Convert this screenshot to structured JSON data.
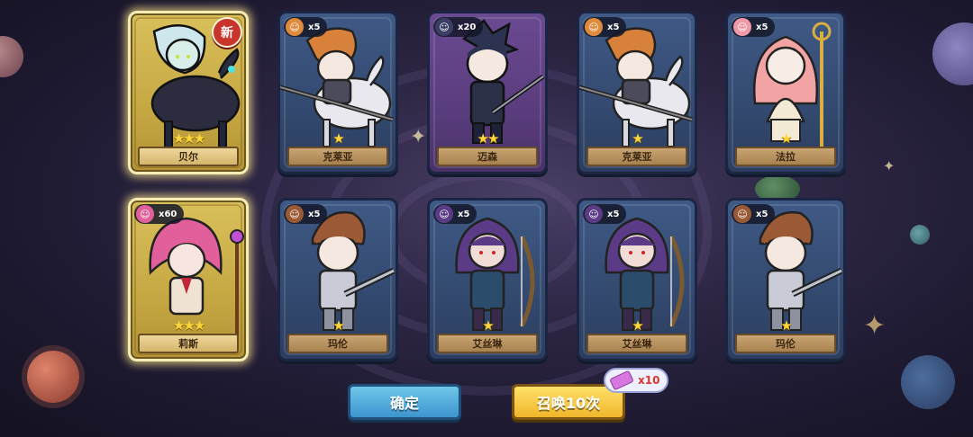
{
  "colors": {
    "gold_card": "#d2b54f",
    "blue_card": "#3f5a86",
    "purple_card": "#6a4a92",
    "star": "#ffd53a",
    "confirm_button": "#4aa6db",
    "summon_button": "#f4c43a",
    "cost_text": "#d83a2a"
  },
  "cards": [
    {
      "name": "贝尔",
      "count": "",
      "stars": "★★★",
      "rarity": "gold",
      "is_new": true,
      "new_label": "新",
      "icon": "dark-rider-portrait"
    },
    {
      "name": "克莱亚",
      "count": "x5",
      "stars": "★",
      "rarity": "blue",
      "is_new": false,
      "icon": "lance-rider-portrait"
    },
    {
      "name": "迈森",
      "count": "x20",
      "stars": "★★",
      "rarity": "purple",
      "is_new": false,
      "icon": "swordsman-portrait"
    },
    {
      "name": "克莱亚",
      "count": "x5",
      "stars": "★",
      "rarity": "blue",
      "is_new": false,
      "icon": "lance-rider-portrait"
    },
    {
      "name": "法拉",
      "count": "x5",
      "stars": "★",
      "rarity": "blue",
      "is_new": false,
      "icon": "priestess-portrait"
    },
    {
      "name": "莉斯",
      "count": "x60",
      "stars": "★★★",
      "rarity": "gold",
      "is_new": false,
      "icon": "mage-girl-portrait"
    },
    {
      "name": "玛伦",
      "count": "x5",
      "stars": "★",
      "rarity": "blue",
      "is_new": false,
      "icon": "knight-portrait"
    },
    {
      "name": "艾丝琳",
      "count": "x5",
      "stars": "★",
      "rarity": "blue",
      "is_new": false,
      "icon": "archer-portrait"
    },
    {
      "name": "艾丝琳",
      "count": "x5",
      "stars": "★",
      "rarity": "blue",
      "is_new": false,
      "icon": "archer-portrait"
    },
    {
      "name": "玛伦",
      "count": "x5",
      "stars": "★",
      "rarity": "blue",
      "is_new": false,
      "icon": "knight-portrait"
    }
  ],
  "buttons": {
    "confirm_label": "确定",
    "summon_label": "召唤10次",
    "summon_cost": "x10",
    "cost_icon": "ticket-icon"
  }
}
